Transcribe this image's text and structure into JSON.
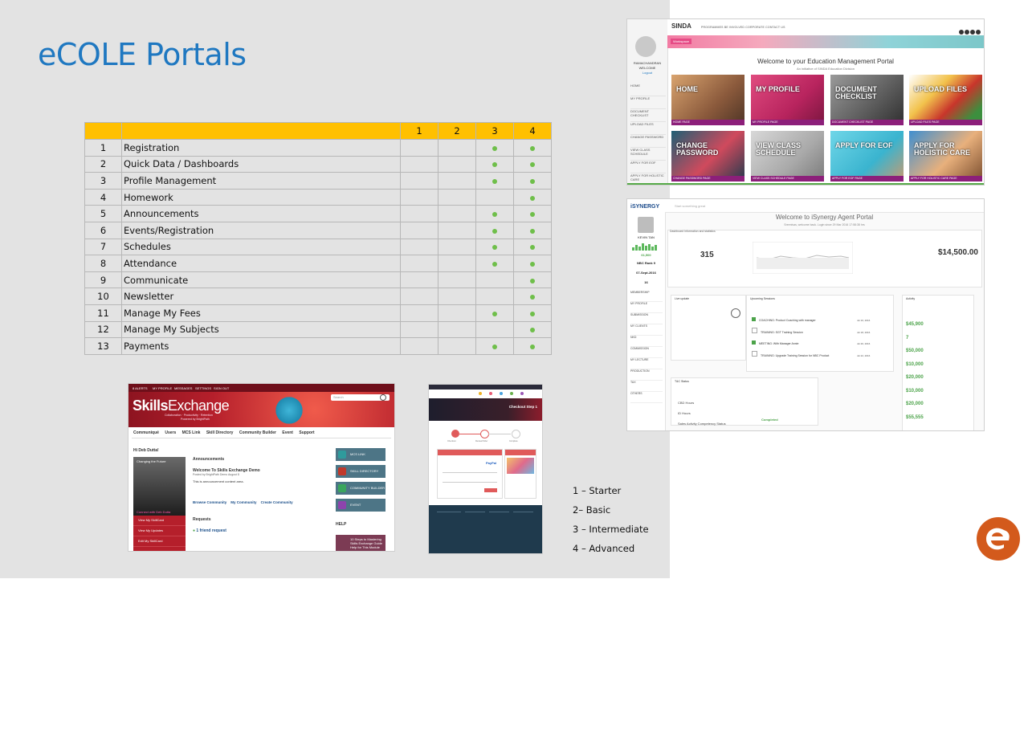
{
  "slide": {
    "title": "eCOLE Portals"
  },
  "table": {
    "headers": [
      "",
      "",
      "1",
      "2",
      "3",
      "4"
    ],
    "rows": [
      {
        "num": "1",
        "name": "Registration",
        "levels": [
          false,
          false,
          true,
          true
        ]
      },
      {
        "num": "2",
        "name": "Quick Data / Dashboards",
        "levels": [
          false,
          false,
          true,
          true
        ]
      },
      {
        "num": "3",
        "name": "Profile Management",
        "levels": [
          false,
          false,
          true,
          true
        ]
      },
      {
        "num": "4",
        "name": "Homework",
        "levels": [
          false,
          false,
          false,
          true
        ]
      },
      {
        "num": "5",
        "name": "Announcements",
        "levels": [
          false,
          false,
          true,
          true
        ]
      },
      {
        "num": "6",
        "name": "Events/Registration",
        "levels": [
          false,
          false,
          true,
          true
        ]
      },
      {
        "num": "7",
        "name": "Schedules",
        "levels": [
          false,
          false,
          true,
          true
        ]
      },
      {
        "num": "8",
        "name": "Attendance",
        "levels": [
          false,
          false,
          true,
          true
        ]
      },
      {
        "num": "9",
        "name": "Communicate",
        "levels": [
          false,
          false,
          false,
          true
        ]
      },
      {
        "num": "10",
        "name": "Newsletter",
        "levels": [
          false,
          false,
          false,
          true
        ]
      },
      {
        "num": "11",
        "name": "Manage My Fees",
        "levels": [
          false,
          false,
          true,
          true
        ]
      },
      {
        "num": "12",
        "name": "Manage My Subjects",
        "levels": [
          false,
          false,
          false,
          true
        ]
      },
      {
        "num": "13",
        "name": "Payments",
        "levels": [
          false,
          false,
          true,
          true
        ]
      }
    ],
    "header_color": "#ffc000",
    "dot_color": "#6fbf4a"
  },
  "legend": {
    "items": [
      "1 – Starter",
      "2– Basic",
      "3 – Intermediate",
      "4 – Advanced"
    ]
  },
  "sinda": {
    "logo": "SINDA",
    "nav": "PROGRAMMES   BE INVOLVED   CORPORATE   CONTACT US",
    "band_label": "Workspace",
    "user_name": "RAMACHANDRAN",
    "user_welcome": "WELCOME",
    "user_logout": "Logout",
    "menu": [
      "HOME",
      "MY PROFILE",
      "DOCUMENT CHECKLIST",
      "UPLOAD FILES",
      "CHANGE PASSWORD",
      "VIEW CLASS SCHEDULE",
      "APPLY FOR EOF",
      "APPLY FOR HOLISTIC CARE"
    ],
    "welcome": "Welcome to your Education Management Portal",
    "subtitle": "An initiative of SINDA Education Division",
    "tiles": [
      {
        "label": "HOME",
        "foot": "HOME PAGE"
      },
      {
        "label": "MY PROFILE",
        "foot": "MY PROFILE PAGE"
      },
      {
        "label": "DOCUMENT CHECKLIST",
        "foot": "DOCUMENT CHECKLIST PAGE"
      },
      {
        "label": "UPLOAD FILES",
        "foot": "UPLOAD FILES PAGE"
      },
      {
        "label": "CHANGE PASSWORD",
        "foot": "CHANGE PASSWORD PAGE"
      },
      {
        "label": "VIEW CLASS SCHEDULE",
        "foot": "VIEW CLASS SCHEDULE PAGE"
      },
      {
        "label": "APPLY FOR EOF",
        "foot": "APPLY FOR EOF PAGE"
      },
      {
        "label": "APPLY FOR HOLISTIC CARE",
        "foot": "APPLY FOR HOLISTIC CARE PAGE"
      }
    ]
  },
  "isynergy": {
    "brand": "iSYNERGY",
    "search": "Start something great",
    "heading": "Welcome to iSynergy Agent Portal",
    "subheading": "Sreenivas, welcome back. Login since 29 Mar 2016 17:58:38 hrs",
    "agent_name": "KEVIN TAN",
    "score": "61,500",
    "rank": "NBC Rank 9",
    "date": "07-Sept-2016",
    "days": "16",
    "section": "Dashboard Information and statistics",
    "big_count": "315",
    "big_amount": "$14,500.00",
    "menu": [
      "MEMBERSHIP",
      "MY PROFILE",
      "SUBMISSION",
      "MY CLIENTS",
      "NKD",
      "COMMISSION",
      "MY LECTURE",
      "PRODUCTION",
      "TAX",
      "OTHERS"
    ],
    "panels": [
      "Live update",
      "Upcoming Sessions",
      "Activity",
      "T&C Status"
    ],
    "activity": [
      "$45,900",
      "7",
      "$50,000",
      "$10,000",
      "$20,000",
      "$10,000",
      "$20,000",
      "$55,555"
    ],
    "status_items": [
      "CBD Hours",
      "ID Hours",
      "Sales Activity Competency Status"
    ],
    "completed": "Completed",
    "sessions": [
      "COACHING: Product Coaching with manager",
      "TRAINING: SGT Training Session",
      "MEETING: With Manager Annie",
      "TRAINING: Upgrade Training Session for NBC Product"
    ],
    "session_dates": [
      "Jul 16, 2016",
      "Jul 18, 2016",
      "Jul 20, 2016",
      "Jul 22, 2016"
    ]
  },
  "skills": {
    "topnav": [
      "8 ALERTS",
      "MY PROFILE",
      "MESSAGES",
      "SETTINGS",
      "SIGN OUT"
    ],
    "search_placeholder": "Search",
    "logo_bold": "Skills",
    "logo_rest": "Exchange",
    "tagline": "Collaboration · Productivity · Retention",
    "powered": "Powered by BrightPath",
    "links": [
      "Communiqué",
      "Users",
      "MCS Link",
      "Skill Directory",
      "Community Builder",
      "Event",
      "Support"
    ],
    "hi": "Hi Deb Dutta!",
    "announcements": "Announcements",
    "ann_title": "Welcome To Skills Exchange Demo",
    "ann_posted": "Posted by BrightPath Demo August 8",
    "ann_body": "This is announcement content area.",
    "browse": [
      "Browse Community",
      "My Community",
      "Create Community"
    ],
    "requests": "Requests",
    "friend_request": "1 friend request",
    "side_buttons": [
      "MCS LINK",
      "SKILL DIRECTORY",
      "COMMUNITY BUILDER",
      "EVENT"
    ],
    "help": "HELP",
    "help_item": "10 Steps to Mastering Skills Exchange Guide",
    "help_item2": "Help for This Module",
    "red_menu": [
      "View My SkillCard",
      "View My Updates",
      "Edit My SkillCard"
    ],
    "photo_caption1": "Changing the Future",
    "photo_caption2": "Connect with Deb Dutta"
  },
  "webthumb": {
    "banner_title": "Checkout Step 1",
    "steps": [
      "Checkout",
      "Review/Order",
      "Complete"
    ],
    "paypal": "PayPal"
  },
  "colors": {
    "title": "#1f78c1",
    "slide_bg": "#e3e3e3",
    "logo": "#d35a1c"
  }
}
